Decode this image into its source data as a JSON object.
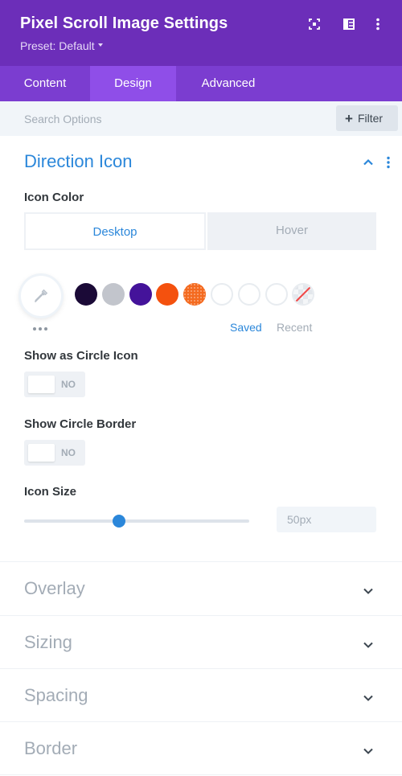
{
  "header": {
    "title": "Pixel Scroll Image Settings",
    "preset_label": "Preset: Default",
    "icons": [
      "expand-icon",
      "split-view-icon",
      "more-vertical-icon"
    ],
    "background": "#6c2eb9"
  },
  "tabs": [
    {
      "label": "Content",
      "active": false
    },
    {
      "label": "Design",
      "active": true
    },
    {
      "label": "Advanced",
      "active": false
    }
  ],
  "search": {
    "placeholder": "Search Options",
    "value": "",
    "filter_label": "Filter"
  },
  "section": {
    "title": "Direction Icon",
    "expanded": true,
    "accent": "#2b87da"
  },
  "icon_color": {
    "label": "Icon Color",
    "modes": [
      "Desktop",
      "Hover"
    ],
    "active_mode": "Desktop",
    "swatches": [
      "#1b0a37",
      "#c2c5cc",
      "#44139a",
      "#f4510e",
      "#f46a1f",
      "",
      "",
      "",
      "none"
    ],
    "saved_label": "Saved",
    "recent_label": "Recent"
  },
  "show_circle_icon": {
    "label": "Show as Circle Icon",
    "state": "NO"
  },
  "show_circle_border": {
    "label": "Show Circle Border",
    "state": "NO"
  },
  "icon_size": {
    "label": "Icon Size",
    "value": "50px",
    "level": 0.42
  },
  "collapsed_sections": [
    "Overlay",
    "Sizing",
    "Spacing",
    "Border"
  ]
}
